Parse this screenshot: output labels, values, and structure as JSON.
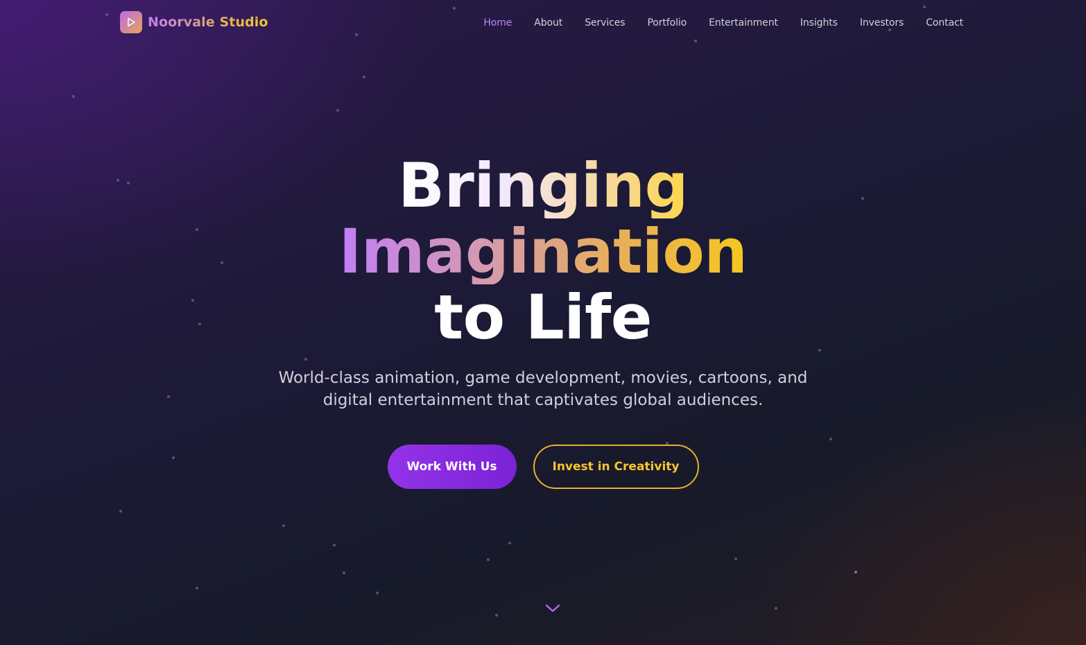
{
  "brand": {
    "name": "Noorvale Studio",
    "logo_icon": "play-icon"
  },
  "nav": {
    "items": [
      {
        "label": "Home",
        "active": true
      },
      {
        "label": "About",
        "active": false
      },
      {
        "label": "Services",
        "active": false
      },
      {
        "label": "Portfolio",
        "active": false
      },
      {
        "label": "Entertainment",
        "active": false
      },
      {
        "label": "Insights",
        "active": false
      },
      {
        "label": "Investors",
        "active": false
      },
      {
        "label": "Contact",
        "active": false
      }
    ]
  },
  "hero": {
    "headline_line1": "Bringing",
    "headline_line2": "Imagination",
    "headline_line3": "to Life",
    "subtitle": "World-class animation, game development, movies, cartoons, and digital entertainment that captivates global audiences.",
    "primary_cta": "Work With Us",
    "secondary_cta": "Invest in Creativity"
  },
  "scroll_cue": {
    "icon": "chevron-down-icon"
  },
  "colors": {
    "accent_purple": "#9333ea",
    "accent_gold": "#fbc531",
    "nav_active": "#b98af7",
    "nav_text": "#d4d0dc",
    "subtitle_text": "#d2cfdb"
  }
}
